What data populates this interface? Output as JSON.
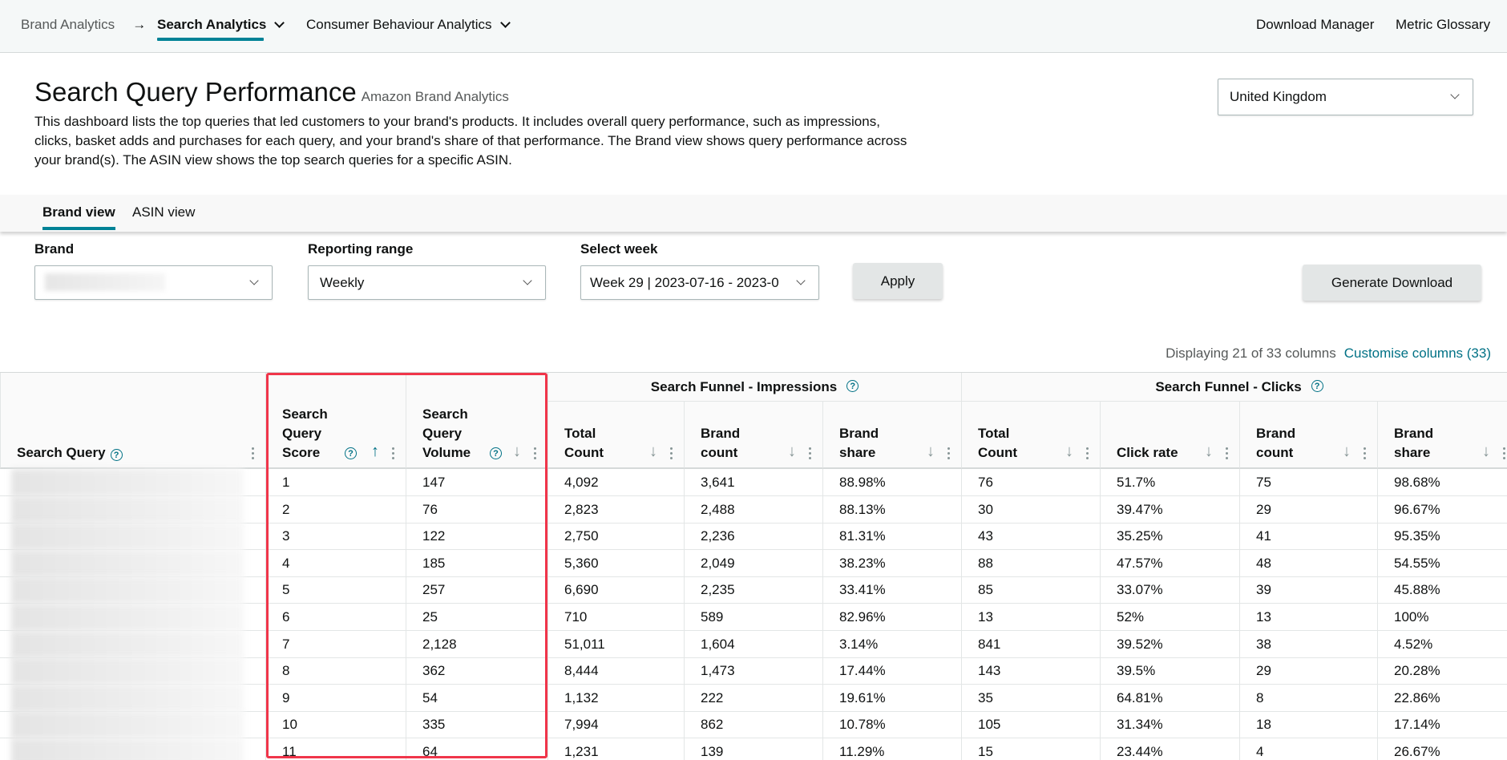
{
  "nav": {
    "breadcrumb_root": "Brand Analytics",
    "active": "Search Analytics",
    "other": "Consumer Behaviour Analytics",
    "download_manager": "Download Manager",
    "metric_glossary": "Metric Glossary"
  },
  "header": {
    "title": "Search Query Performance",
    "subtitle": "Amazon Brand Analytics",
    "description": "This dashboard lists the top queries that led customers to your brand's products. It includes overall query performance, such as impressions, clicks, basket adds and purchases for each query, and your brand's share of that performance. The Brand view shows query performance across your brand(s). The ASIN view shows the top search queries for a specific ASIN.",
    "country": "United Kingdom"
  },
  "tabs": [
    {
      "label": "Brand view",
      "active": true
    },
    {
      "label": "ASIN view",
      "active": false
    }
  ],
  "filters": {
    "brand_label": "Brand",
    "brand_value": "",
    "range_label": "Reporting range",
    "range_value": "Weekly",
    "week_label": "Select week",
    "week_value": "Week 29 | 2023-07-16 - 2023-0",
    "apply": "Apply",
    "generate": "Generate Download"
  },
  "table_info": {
    "displaying": "Displaying 21 of 33 columns",
    "customise": "Customise columns (33)"
  },
  "groups": [
    "Search Funnel - Impressions",
    "Search Funnel - Clicks"
  ],
  "columns": [
    "Search Query",
    "Search Query Score",
    "Search Query Volume",
    "Total Count",
    "Brand count",
    "Brand share",
    "Total Count",
    "Click rate",
    "Brand count",
    "Brand share"
  ],
  "rows": [
    [
      "1",
      "147",
      "4,092",
      "3,641",
      "88.98%",
      "76",
      "51.7%",
      "75",
      "98.68%"
    ],
    [
      "2",
      "76",
      "2,823",
      "2,488",
      "88.13%",
      "30",
      "39.47%",
      "29",
      "96.67%"
    ],
    [
      "3",
      "122",
      "2,750",
      "2,236",
      "81.31%",
      "43",
      "35.25%",
      "41",
      "95.35%"
    ],
    [
      "4",
      "185",
      "5,360",
      "2,049",
      "38.23%",
      "88",
      "47.57%",
      "48",
      "54.55%"
    ],
    [
      "5",
      "257",
      "6,690",
      "2,235",
      "33.41%",
      "85",
      "33.07%",
      "39",
      "45.88%"
    ],
    [
      "6",
      "25",
      "710",
      "589",
      "82.96%",
      "13",
      "52%",
      "13",
      "100%"
    ],
    [
      "7",
      "2,128",
      "51,011",
      "1,604",
      "3.14%",
      "841",
      "39.52%",
      "38",
      "4.52%"
    ],
    [
      "8",
      "362",
      "8,444",
      "1,473",
      "17.44%",
      "143",
      "39.5%",
      "29",
      "20.28%"
    ],
    [
      "9",
      "54",
      "1,132",
      "222",
      "19.61%",
      "35",
      "64.81%",
      "8",
      "22.86%"
    ],
    [
      "10",
      "335",
      "7,994",
      "862",
      "10.78%",
      "105",
      "31.34%",
      "18",
      "17.14%"
    ],
    [
      "11",
      "64",
      "1,231",
      "139",
      "11.29%",
      "15",
      "23.44%",
      "4",
      "26.67%"
    ]
  ],
  "colors": {
    "accent": "#008296",
    "link": "#007185",
    "highlight": "#f0354a"
  }
}
